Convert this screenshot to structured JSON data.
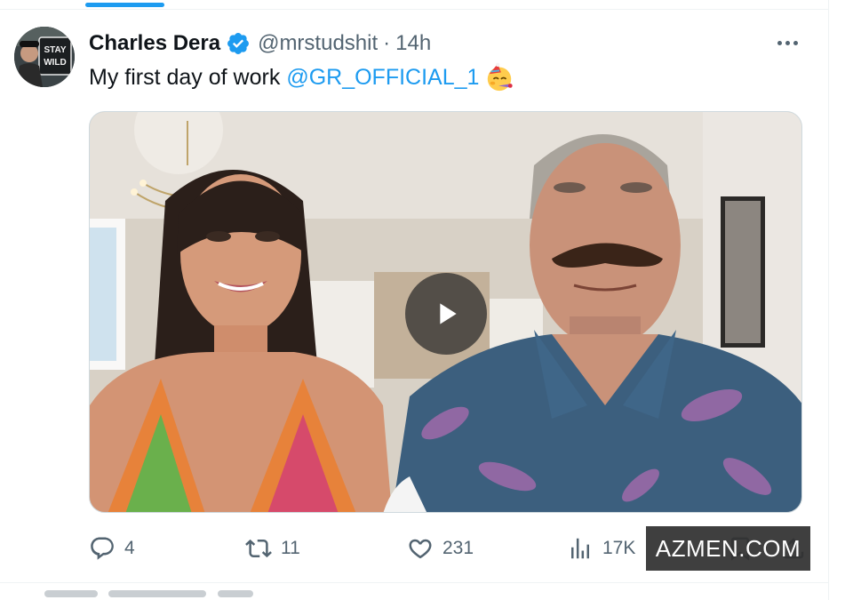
{
  "tweet": {
    "author": {
      "display_name": "Charles Dera",
      "handle": "@mrstudshit",
      "verified": true,
      "avatar_text": [
        "STAY",
        "WILD"
      ]
    },
    "separator": "·",
    "time": "14h",
    "text": "My first day of work",
    "mention": "@GR_OFFICIAL_1",
    "emoji": "party-face-emoji",
    "media": {
      "type": "video",
      "play_icon": "play-icon"
    },
    "actions": {
      "replies": "4",
      "retweets": "11",
      "likes": "231",
      "views": "17K"
    }
  },
  "watermark": "AZMEN.COM",
  "colors": {
    "accent": "#1d9bf0",
    "text_primary": "#0f1419",
    "text_secondary": "#536471",
    "divider": "#eff3f4"
  }
}
